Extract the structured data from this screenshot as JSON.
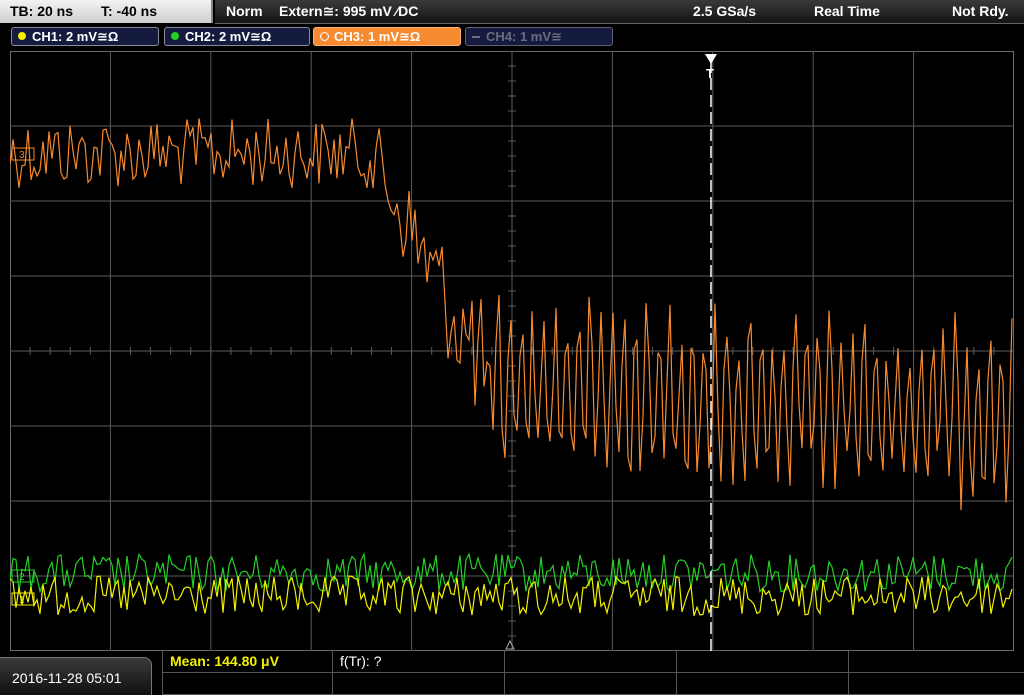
{
  "status": {
    "timebase": "TB: 20 ns",
    "trigger_time": "T: -40 ns",
    "trigger_mode": "Norm",
    "trigger_source": "Extern≅: 995 mV ∕DC",
    "sample_rate": "2.5 GSa/s",
    "acq_mode": "Real Time",
    "state": "Not Rdy."
  },
  "channels": [
    {
      "label": "CH1: 2 mV≅Ω",
      "color": "#f2f200"
    },
    {
      "label": "CH2: 2 mV≅Ω",
      "color": "#25d025"
    },
    {
      "label": "CH3: 1 mV≅Ω",
      "color": "#f58a30"
    },
    {
      "label": "CH4: 1 mV≅",
      "color": "#6c6c7c"
    }
  ],
  "trigger_marker": "T",
  "markers": {
    "ch3": "3",
    "ch1": "1",
    "ch2": "2"
  },
  "footer": {
    "datetime": "2016-11-28 05:01",
    "measure_mean": "Mean: 144.80 μV",
    "measure_ftr": "f(Tr): ?"
  },
  "colors": {
    "ch1": "#f2f200",
    "ch2": "#25d025",
    "ch3": "#f58a30",
    "grid": "#5a5a5a"
  }
}
